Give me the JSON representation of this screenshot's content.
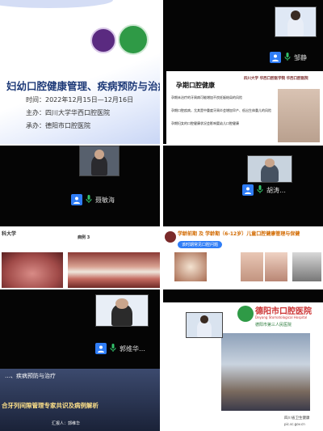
{
  "panel1": {
    "title": "妇幼口腔健康管理、疾病预防与治疗",
    "date": "时间：2022年12月15日—12月16日",
    "host": "主办：四川大学华西口腔医院",
    "organizer": "承办：德阳市口腔医院"
  },
  "panel2": {
    "participant": "邹静",
    "slide_title": "孕期口腔健康",
    "slide_header": "四川大学 华西口腔医学院 华西口腔医院",
    "bullets": [
      "孕期未治疗的牙周病可能增加不良妊娠结局的风险",
      "孕期口腔疾病，尤其是中重度牙周炎会增加早产、低出生体重儿的风险",
      "孕期妇女的口腔健康状况会影响婴幼儿口腔健康"
    ]
  },
  "panel3": {
    "participant": "聂敏海"
  },
  "panel4": {
    "participant": "胡涛…"
  },
  "panel5": {
    "header_left": "科大学",
    "case_label": "病例 3"
  },
  "panel6": {
    "title": "学龄前期 及 学龄期（6-12岁）儿童口腔健康管理与保健",
    "tag": "该时期常见口腔问题"
  },
  "panel7": {
    "participant": "郭维华…",
    "slide_line1": "…、疾病预防与治疗",
    "slide_line2": "合牙列间隙管理专家共识及病例解析",
    "reporter": "汇报人：郭维华"
  },
  "panel8": {
    "header": "德阳市口腔医院",
    "header_en": "Deyang Stomatological Hospital",
    "subheader": "德阳市第三人民医院",
    "watermark1": "四川省卫生健康",
    "watermark2": "pic.sc.gov.cn"
  },
  "colors": {
    "accent_blue": "#2f7df6",
    "slide_navy": "#1e3a78"
  }
}
